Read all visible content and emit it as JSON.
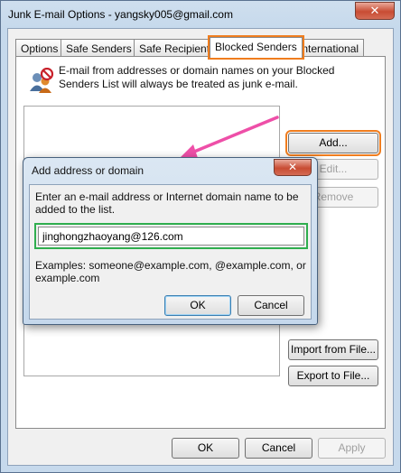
{
  "window": {
    "title": "Junk E-mail Options - yangsky005@gmail.com",
    "close_glyph": "✕"
  },
  "tabs": [
    {
      "label": "Options"
    },
    {
      "label": "Safe Senders"
    },
    {
      "label": "Safe Recipients"
    },
    {
      "label": "Blocked Senders"
    },
    {
      "label": "International"
    }
  ],
  "blocked": {
    "description": "E-mail from addresses or domain names on your Blocked Senders List will always be treated as junk e-mail.",
    "add_label": "Add...",
    "edit_label": "Edit...",
    "remove_label": "Remove",
    "import_label": "Import from File...",
    "export_label": "Export to File..."
  },
  "footer": {
    "ok_label": "OK",
    "cancel_label": "Cancel",
    "apply_label": "Apply"
  },
  "dialog": {
    "title": "Add address or domain",
    "close_glyph": "✕",
    "prompt": "Enter an e-mail address or Internet domain name to be added to the list.",
    "input_value": "jinghongzhaoyang@126.com",
    "examples": "Examples: someone@example.com, @example.com, or example.com",
    "ok_label": "OK",
    "cancel_label": "Cancel"
  },
  "colors": {
    "highlight_orange": "#f07d1e",
    "highlight_green": "#2fae4e",
    "arrow_pink": "#ee4fa8"
  }
}
